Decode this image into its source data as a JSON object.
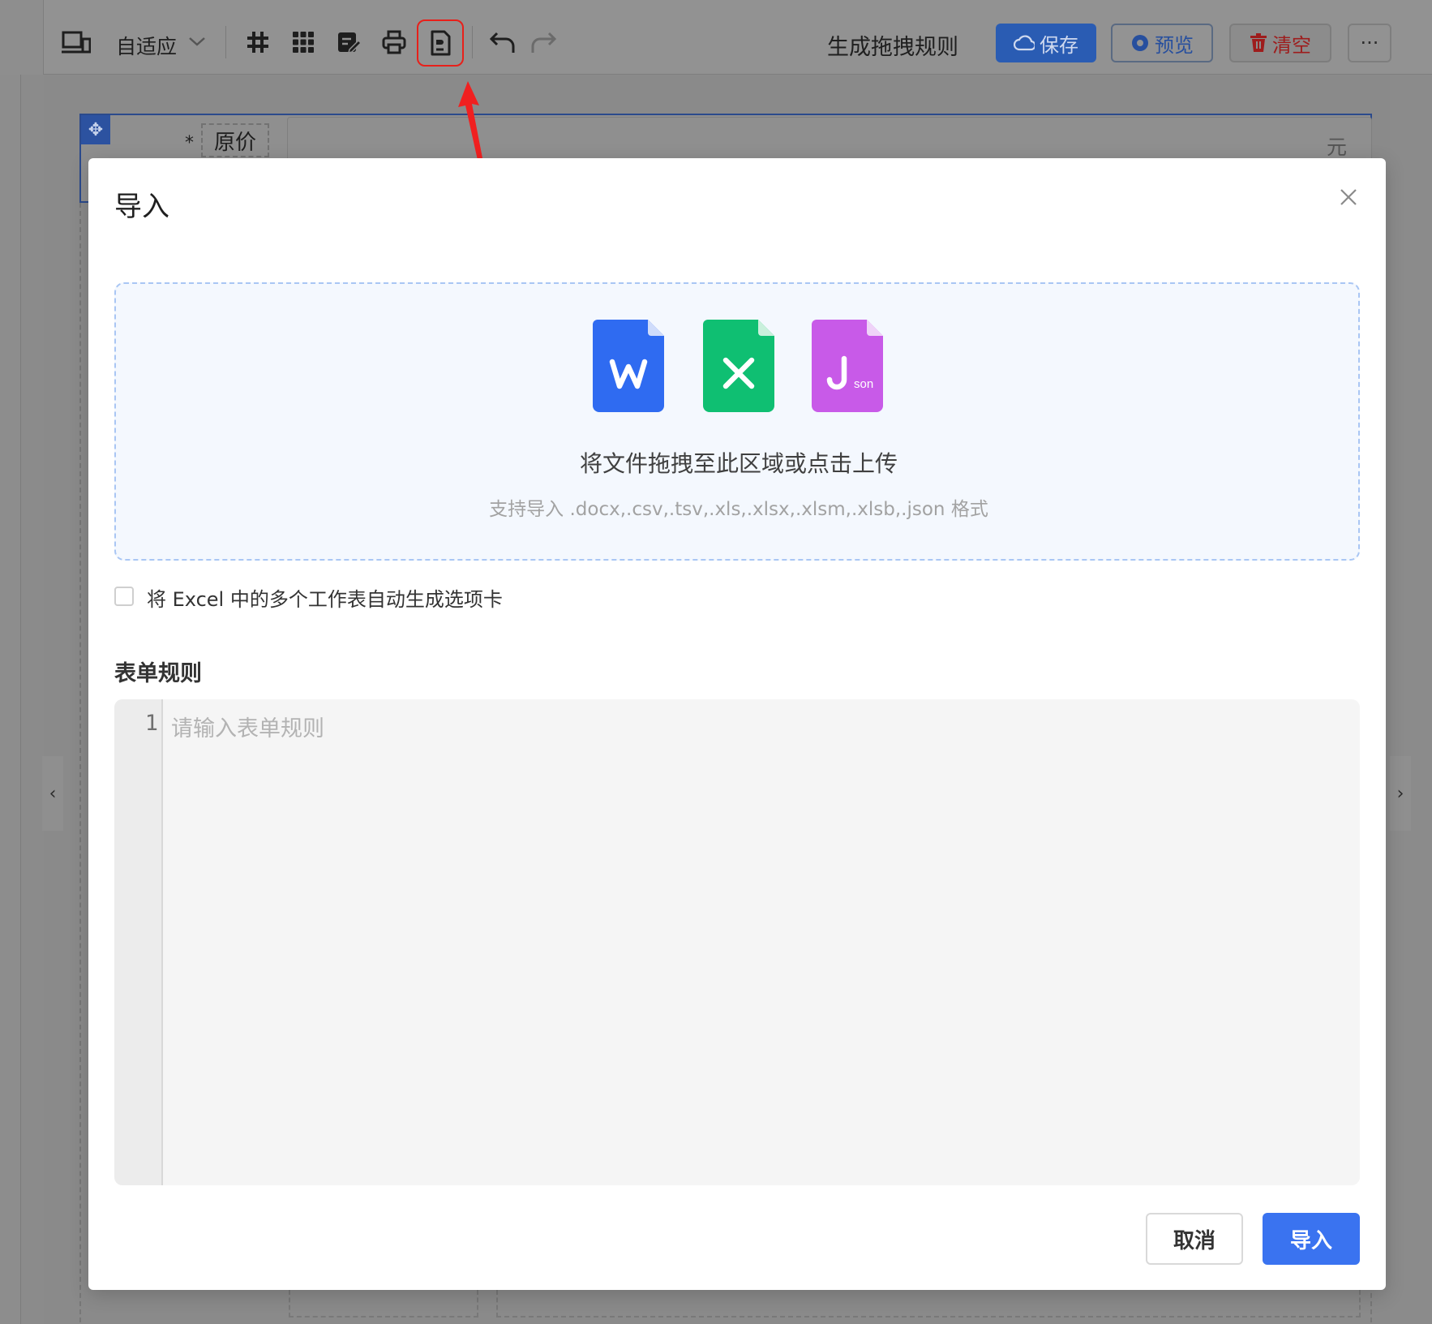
{
  "toolbar": {
    "device_label": "自适应",
    "title": "生成拖拽规则",
    "save_label": "保存",
    "preview_label": "预览",
    "clear_label": "清空",
    "more_label": "···"
  },
  "canvas": {
    "field_label": "原价",
    "required_mark": "*",
    "field_unit": "元"
  },
  "modal": {
    "title": "导入",
    "dropzone": {
      "icons": [
        {
          "name": "word-file-icon",
          "letter": "W",
          "color": "#2f6bf1"
        },
        {
          "name": "excel-file-icon",
          "letter": "X",
          "color": "#0fbf72"
        },
        {
          "name": "json-file-icon",
          "letter": "J",
          "suffix": "son",
          "color": "#c85ae8"
        }
      ],
      "main_text": "将文件拖拽至此区域或点击上传",
      "sub_text": "支持导入 .docx,.csv,.tsv,.xls,.xlsx,.xlsm,.xlsb,.json 格式"
    },
    "checkbox_label": "将 Excel 中的多个工作表自动生成选项卡",
    "checkbox_checked": false,
    "rules_title": "表单规则",
    "editor": {
      "line_number": "1",
      "placeholder": "请输入表单规则",
      "value": ""
    },
    "cancel_label": "取消",
    "import_label": "导入"
  },
  "colors": {
    "accent": "#3a73f0",
    "highlight": "#e8201a",
    "dropzone_border": "#a9c6f4",
    "dropzone_bg": "#f4f8fe"
  }
}
